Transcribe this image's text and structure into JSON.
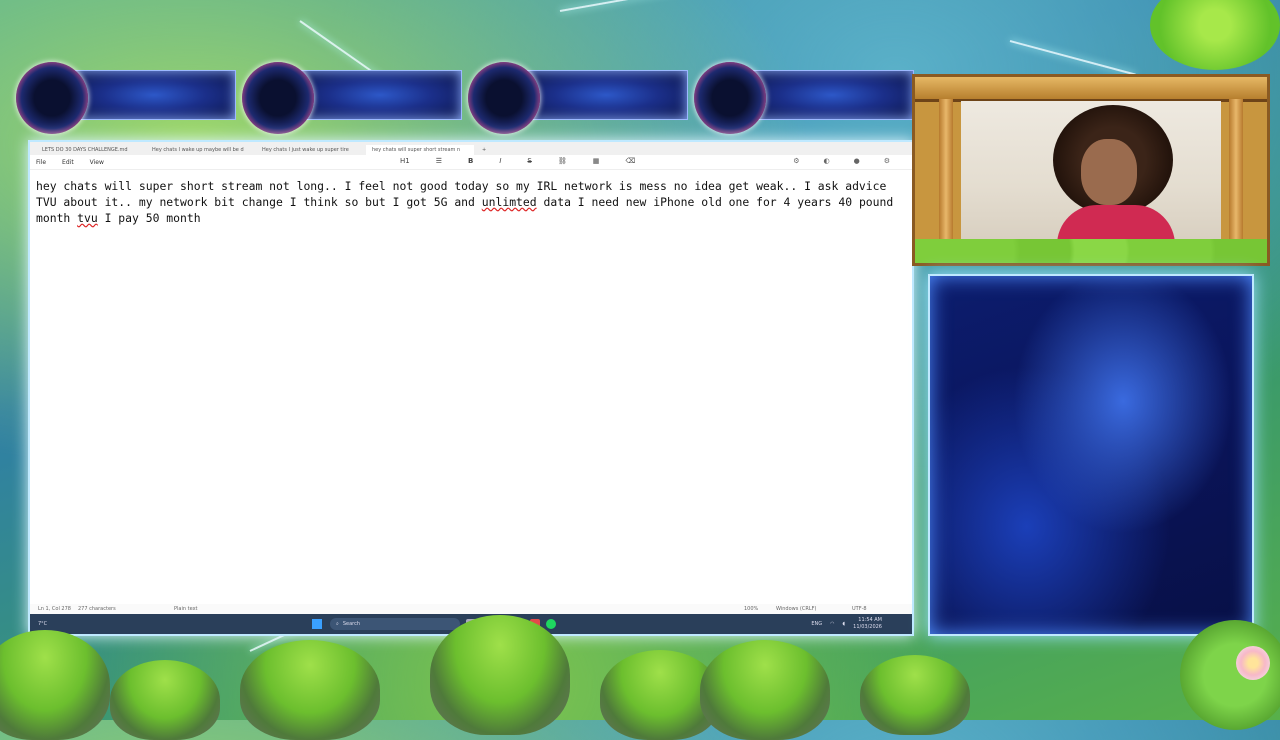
{
  "notepad": {
    "tabs": [
      "LETS DO 30 DAYS CHALLENGE.md",
      "Hey chats I wake up maybe will be d",
      "Hey chats I just wake up super tire",
      "hey chats will super short stream n"
    ],
    "tab_add": "+",
    "menu": {
      "file": "File",
      "edit": "Edit",
      "view": "View"
    },
    "format": {
      "heading": "H1",
      "bold": "B",
      "italic": "I",
      "strike": "S"
    },
    "content": {
      "part1": "hey chats will super short stream not long.. I feel not good today so my IRL network is mess no idea get weak.. I ask advice TVU about it.. my network bit change I think so but I got 5G and ",
      "misspelled1": "unlimted",
      "part2": " data I need new iPhone old one for 4 years 40 pound month ",
      "misspelled2": "tvu",
      "part3": " I pay 50 month"
    },
    "status": {
      "position": "Ln 1, Col 278",
      "characters": "277 characters",
      "format": "Plain text",
      "zoom": "100%",
      "line_ending": "Windows (CRLF)",
      "encoding": "UTF-8"
    }
  },
  "taskbar": {
    "weather": "7°C",
    "search_placeholder": "Search",
    "language": "ENG",
    "time": "11:54 AM",
    "date": "11/03/2026"
  }
}
